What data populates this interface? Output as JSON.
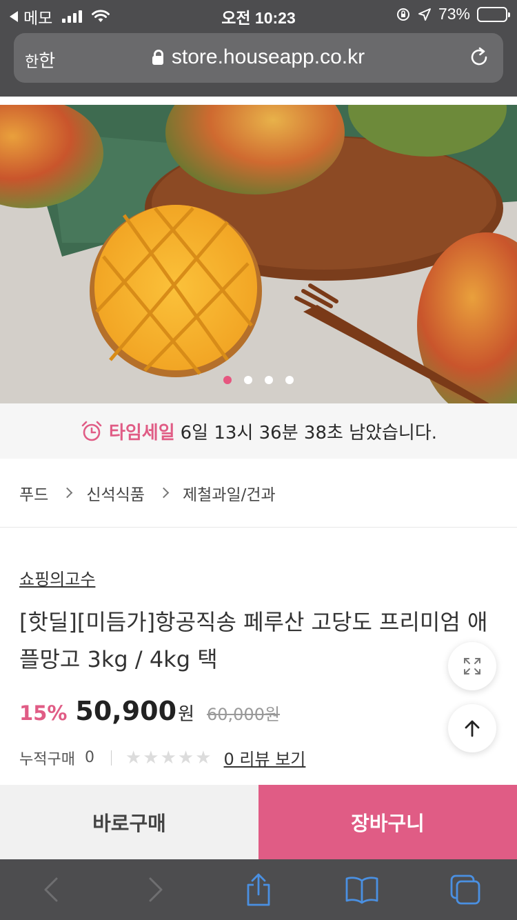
{
  "status_bar": {
    "back_app": "메모",
    "time": "오전 10:23",
    "battery": "73%",
    "battery_level": 0.73
  },
  "browser": {
    "aa_label_small": "한",
    "aa_label_large": "한",
    "url": "store.houseapp.co.kr"
  },
  "carousel": {
    "slide_count": 4,
    "active_index": 0
  },
  "time_sale": {
    "label": "타임세일",
    "remaining": "6일 13시 36분 38초 남았습니다."
  },
  "breadcrumb": {
    "items": [
      "푸드",
      "신석식품",
      "제철과일/건과"
    ]
  },
  "product": {
    "brand": "쇼핑의고수",
    "title": "[핫딜][미듬가]항공직송 페루산 고당도 프리미엄 애플망고 3kg / 4kg 택",
    "discount": "15%",
    "price": "50,900",
    "currency": "원",
    "original_price": "60,000원",
    "cumulative_label": "누적구매",
    "cumulative_count": "0",
    "rating": 0,
    "review_link": "0 리뷰 보기"
  },
  "actions": {
    "buy_now": "바로구매",
    "cart": "장바구니"
  },
  "colors": {
    "accent": "#e05c85",
    "browser_chrome": "#4d4d4f",
    "toolbar_icon": "#4a90e2"
  }
}
